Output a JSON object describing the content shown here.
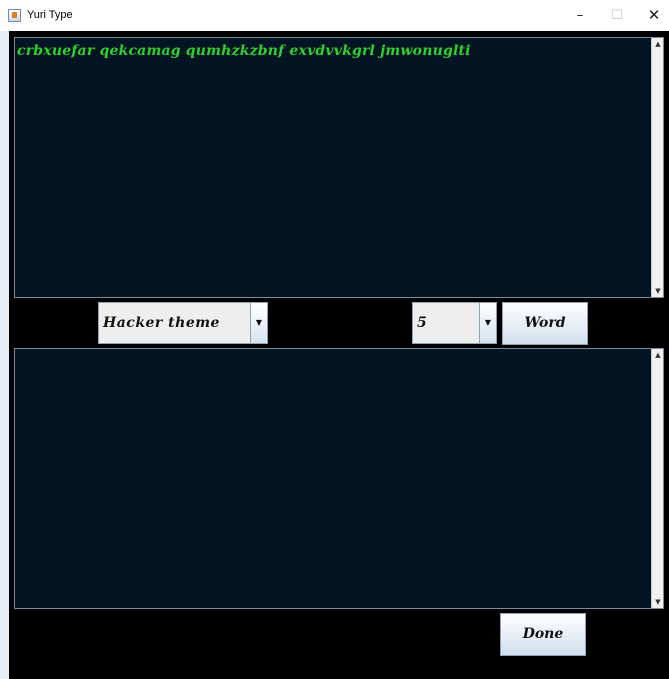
{
  "window": {
    "title": "Yuri Type",
    "minimize_glyph": "–",
    "maximize_glyph": "☐",
    "close_glyph": "✕",
    "icon": "java-cup-icon"
  },
  "target_area": {
    "text": "crbxuefar qekcamag qumhzkzbnf exvdvvkgrl jmwonuglti"
  },
  "typing_area": {
    "text": ""
  },
  "controls": {
    "theme_selected": "Hacker theme",
    "word_count_selected": "5",
    "word_button_label": "Word",
    "done_button_label": "Done"
  },
  "colors": {
    "background": "#000000",
    "text_area_background": "#031422",
    "text_color": "#2fd12f"
  }
}
